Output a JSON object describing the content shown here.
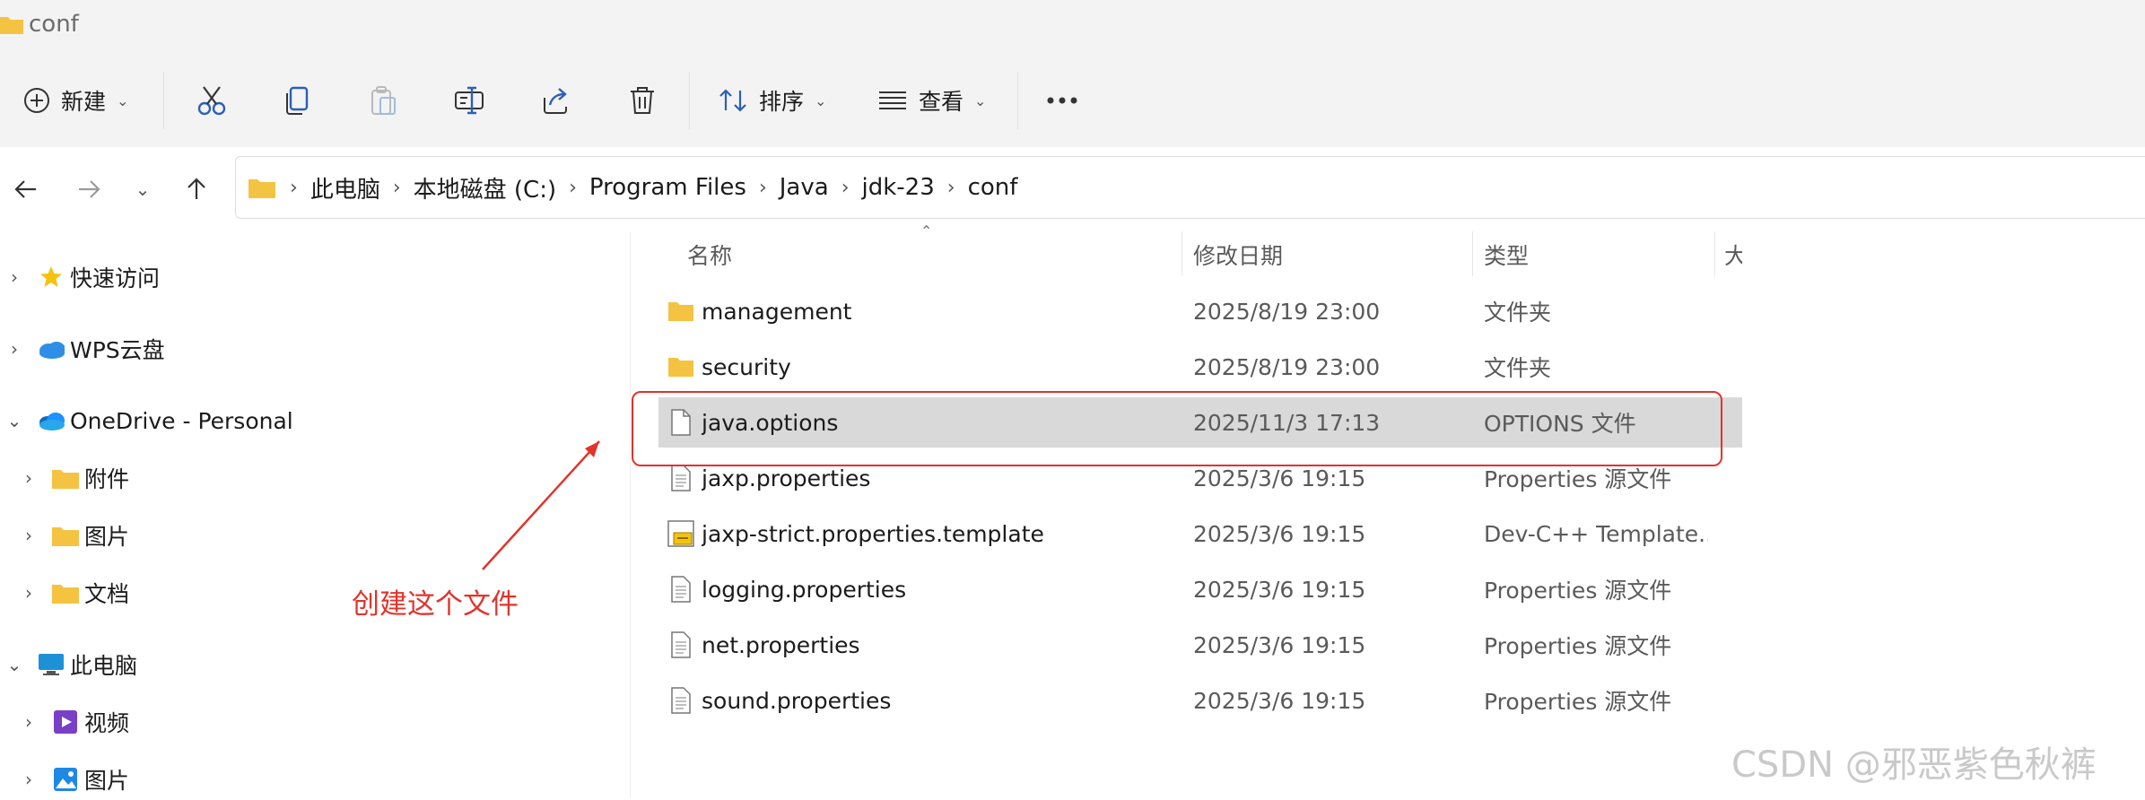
{
  "window": {
    "title": "conf"
  },
  "toolbar": {
    "new_label": "新建",
    "sort_label": "排序",
    "view_label": "查看",
    "icons": [
      "cut-icon",
      "copy-icon",
      "paste-icon",
      "rename-icon",
      "share-icon",
      "delete-icon",
      "more-icon"
    ]
  },
  "breadcrumbs": [
    "此电脑",
    "本地磁盘 (C:)",
    "Program Files",
    "Java",
    "jdk-23",
    "conf"
  ],
  "sidebar": {
    "items": [
      {
        "label": "快速访问",
        "icon": "star-icon"
      },
      {
        "label": "WPS云盘",
        "icon": "cloud-icon"
      },
      {
        "label": "OneDrive - Personal",
        "icon": "onedrive-icon"
      },
      {
        "label": "附件",
        "icon": "folder-icon"
      },
      {
        "label": "图片",
        "icon": "folder-icon"
      },
      {
        "label": "文档",
        "icon": "folder-icon"
      },
      {
        "label": "此电脑",
        "icon": "computer-icon"
      },
      {
        "label": "视频",
        "icon": "videos-icon"
      },
      {
        "label": "图片",
        "icon": "pictures-icon"
      }
    ]
  },
  "columns": {
    "name": "名称",
    "date": "修改日期",
    "type": "类型",
    "size": "大"
  },
  "files": [
    {
      "name": "management",
      "date": "2025/8/19 23:00",
      "type": "文件夹",
      "icon": "folder-icon"
    },
    {
      "name": "security",
      "date": "2025/8/19 23:00",
      "type": "文件夹",
      "icon": "folder-icon"
    },
    {
      "name": "java.options",
      "date": "2025/11/3 17:13",
      "type": "OPTIONS 文件",
      "icon": "blank-file-icon",
      "selected": true
    },
    {
      "name": "jaxp.properties",
      "date": "2025/3/6 19:15",
      "type": "Properties 源文件",
      "icon": "text-file-icon"
    },
    {
      "name": "jaxp-strict.properties.template",
      "date": "2025/3/6 19:15",
      "type": "Dev-C++ Template...",
      "icon": "template-file-icon"
    },
    {
      "name": "logging.properties",
      "date": "2025/3/6 19:15",
      "type": "Properties 源文件",
      "icon": "text-file-icon"
    },
    {
      "name": "net.properties",
      "date": "2025/3/6 19:15",
      "type": "Properties 源文件",
      "icon": "text-file-icon"
    },
    {
      "name": "sound.properties",
      "date": "2025/3/6 19:15",
      "type": "Properties 源文件",
      "icon": "text-file-icon"
    }
  ],
  "annotation": {
    "text": "创建这个文件"
  },
  "watermark": "CSDN @邪恶紫色秋裤",
  "colors": {
    "annotation": "#e0342d",
    "selection": "#d9d9d9",
    "folder": "#f4c342"
  }
}
